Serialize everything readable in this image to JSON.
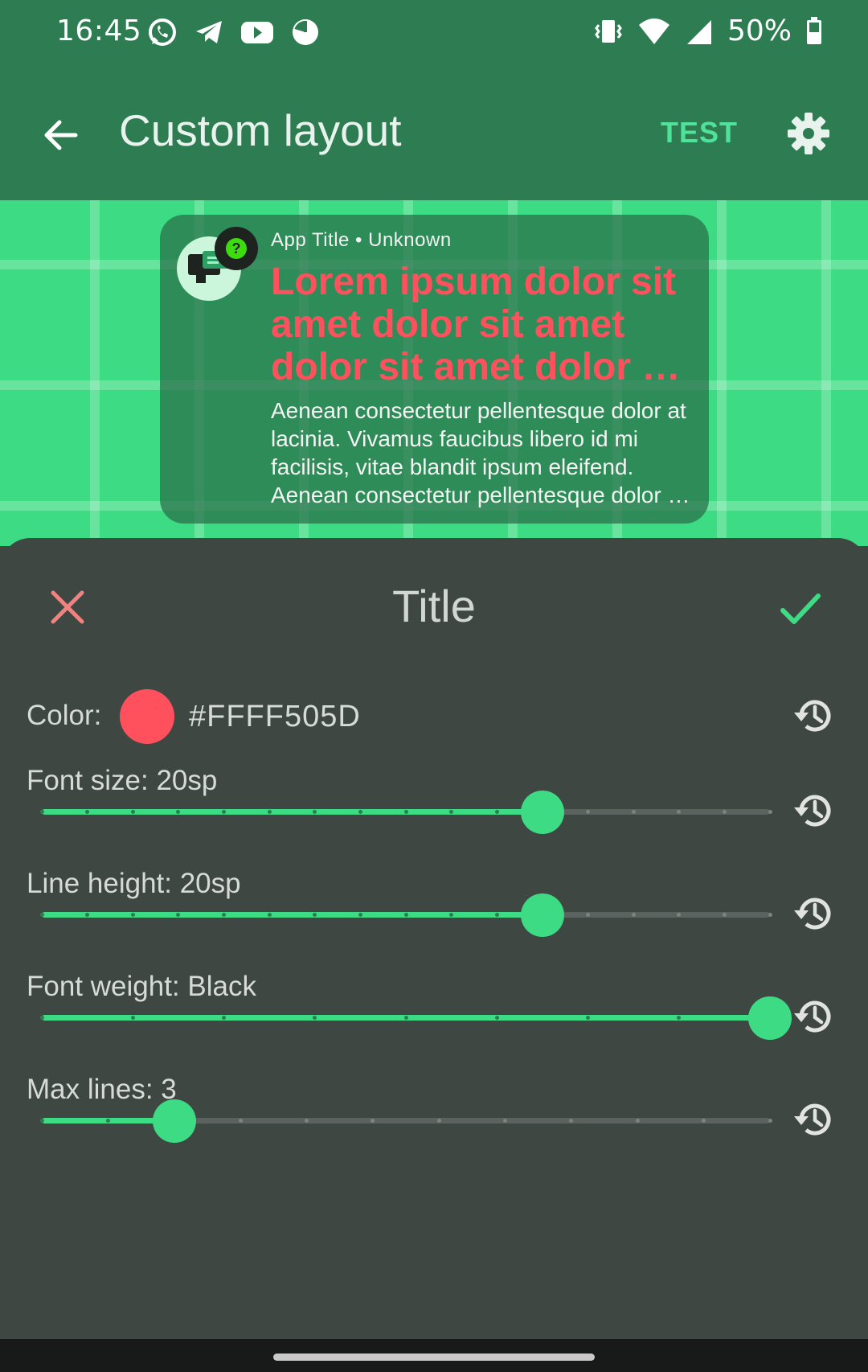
{
  "status_bar": {
    "time": "16:45",
    "battery": "50%",
    "left_icons": [
      "whatsapp-icon",
      "telegram-icon",
      "youtube-icon",
      "data-saver-icon"
    ],
    "right_icons": [
      "vibrate-icon",
      "wifi-icon",
      "signal-icon",
      "battery-icon"
    ]
  },
  "app_bar": {
    "title": "Custom layout",
    "test_label": "TEST",
    "colors": {
      "background": "#2e7d52",
      "accent": "#4fe29a"
    }
  },
  "notification_preview": {
    "header": "App Title • Unknown",
    "title": "Lorem ipsum dolor sit amet dolor sit amet dolor sit amet dolor sit amet",
    "text": "Aenean consectetur pellentesque dolor at lacinia. Vivamus faucibus libero id mi facilisis, vitae blandit ipsum eleifend. Aenean consectetur pellentesque dolor at lacinia.",
    "title_color": "#ff505d",
    "badge_icon": "question-icon"
  },
  "sheet": {
    "title": "Title",
    "color": {
      "label": "Color:",
      "value_hex": "#FFFF505D",
      "swatch": "#ff505d"
    },
    "font_size": {
      "label": "Font size: 20sp",
      "value_fraction": 0.6875,
      "ticks": 17
    },
    "line_height": {
      "label": "Line height: 20sp",
      "value_fraction": 0.6875,
      "ticks": 17
    },
    "font_weight": {
      "label": "Font weight: Black",
      "value_fraction": 1.0,
      "ticks": 9
    },
    "max_lines": {
      "label": "Max lines: 3",
      "value_fraction": 0.1818,
      "ticks": 12
    }
  }
}
